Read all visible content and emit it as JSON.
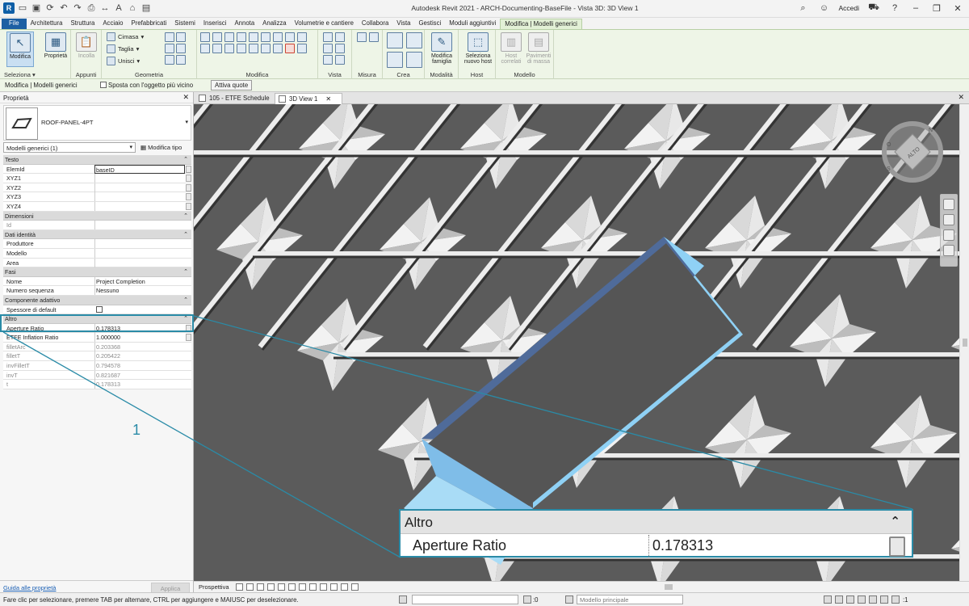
{
  "window": {
    "title": "Autodesk Revit 2021 - ARCH-Documenting-BaseFile - Vista 3D: 3D View 1",
    "sign_in": "Accedi",
    "help": "?"
  },
  "menu": {
    "tabs": [
      "File",
      "Architettura",
      "Struttura",
      "Acciaio",
      "Prefabbricati",
      "Sistemi",
      "Inserisci",
      "Annota",
      "Analizza",
      "Volumetrie e cantiere",
      "Collabora",
      "Vista",
      "Gestisci",
      "Moduli aggiuntivi",
      "Modifica | Modelli generici"
    ],
    "active_index": 14
  },
  "ribbon": {
    "modifica_label": "Modifica",
    "seleziona_label": "Seleziona",
    "proprieta_label": "Proprietà",
    "incolla_label": "Incolla",
    "appunti_label": "Appunti",
    "cimasa_label": "Cimasa",
    "taglia_label": "Taglia",
    "unisci_label": "Unisci",
    "geometria_label": "Geometria",
    "modifica_group_label": "Modifica",
    "vista_label": "Vista",
    "misura_label": "Misura",
    "crea_label": "Crea",
    "modifica_famiglia_label": "Modifica famiglia",
    "modalita_label": "Modalità",
    "seleziona_nuovo_host_label": "Seleziona nuovo host",
    "host_label": "Host",
    "host_correlati_label": "Host correlati",
    "pavimenti_di_massa_label": "Pavimenti di massa",
    "modello_label": "Modello"
  },
  "options_bar": {
    "context": "Modifica | Modelli generici",
    "snap_checkbox": "Sposta con l'oggetto più vicino",
    "activate_button": "Attiva quote"
  },
  "properties": {
    "title": "Proprietà",
    "type_name": "ROOF-PANEL-4PT",
    "filter": "Modelli generici (1)",
    "edit_type": "Modifica tipo",
    "help_link": "Guida alle proprietà",
    "apply": "Applica",
    "rows": [
      {
        "kind": "cat",
        "label": "Testo"
      },
      {
        "kind": "row",
        "key": "ElemId",
        "value": "baseID",
        "boxed": true
      },
      {
        "kind": "row",
        "key": "XYZ1",
        "value": ""
      },
      {
        "kind": "row",
        "key": "XYZ2",
        "value": ""
      },
      {
        "kind": "row",
        "key": "XYZ3",
        "value": ""
      },
      {
        "kind": "row",
        "key": "XYZ4",
        "value": ""
      },
      {
        "kind": "cat",
        "label": "Dimensioni"
      },
      {
        "kind": "row",
        "key": "Id",
        "value": "",
        "gray": true
      },
      {
        "kind": "cat",
        "label": "Dati identità"
      },
      {
        "kind": "row",
        "key": "Produttore",
        "value": ""
      },
      {
        "kind": "row",
        "key": "Modello",
        "value": ""
      },
      {
        "kind": "row",
        "key": "Area",
        "value": ""
      },
      {
        "kind": "cat",
        "label": "Fasi"
      },
      {
        "kind": "row",
        "key": "Nome",
        "value": "Project Completion"
      },
      {
        "kind": "row",
        "key": "Numero sequenza",
        "value": "Nessuno"
      },
      {
        "kind": "cat",
        "label": "Componente adattivo"
      },
      {
        "kind": "check",
        "key": "Spessore di default",
        "checked": false
      },
      {
        "kind": "cat",
        "label": "Altro"
      },
      {
        "kind": "row",
        "key": "Aperture Ratio",
        "value": "0.178313"
      },
      {
        "kind": "row",
        "key": "ETFE Inflation Ratio",
        "value": "1.000000"
      },
      {
        "kind": "row",
        "key": "filletArc",
        "value": "0.203368",
        "gray": true
      },
      {
        "kind": "row",
        "key": "filletT",
        "value": "0.205422",
        "gray": true
      },
      {
        "kind": "row",
        "key": "invFilletT",
        "value": "0.794578",
        "gray": true
      },
      {
        "kind": "row",
        "key": "invT",
        "value": "0.821687",
        "gray": true
      },
      {
        "kind": "row",
        "key": "t",
        "value": "0.178313",
        "gray": true
      }
    ]
  },
  "view_tabs": {
    "tab1": "105 - ETFE Schedule",
    "tab2": "3D View 1"
  },
  "view_cube": {
    "face": "ALTO",
    "n": "N",
    "o": "O",
    "s": "S"
  },
  "view_bar": {
    "label": "Prospettiva"
  },
  "status": {
    "message": "Fare clic per selezionare, premere TAB per alternare, CTRL per aggiungere e MAIUSC per deselezionare.",
    "workset": "Modello principale",
    "zero": ":0",
    "filter_count": ":1"
  },
  "callout": {
    "number": "1",
    "zoom_category": "Altro",
    "zoom_key": "Aperture Ratio",
    "zoom_value": "0.178313"
  },
  "colors": {
    "accent": "#2a8ba7",
    "file_tab": "#1d5fa3",
    "ribbon_bg": "#eef5e7",
    "selection_blue": "#8fd1f5"
  }
}
